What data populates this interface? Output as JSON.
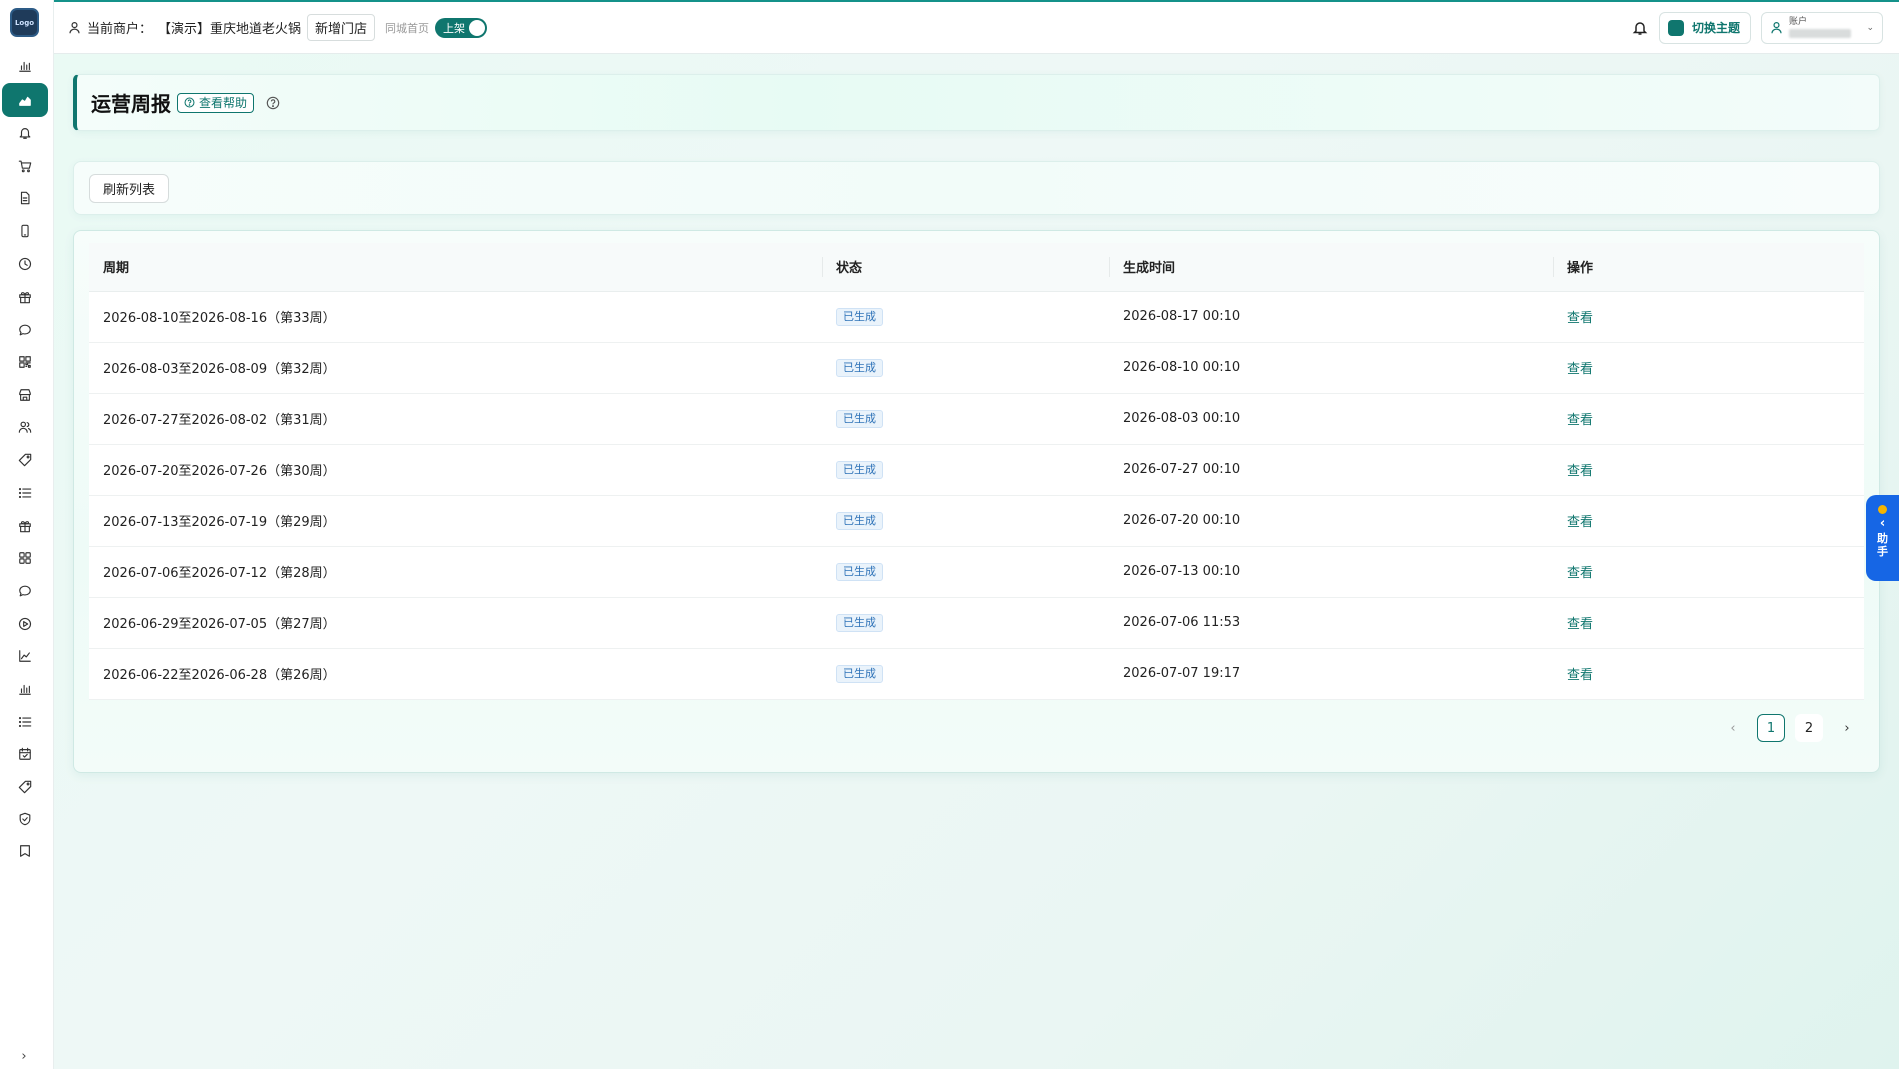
{
  "header": {
    "merchant_label": "当前商户：",
    "merchant_name": "【演示】重庆地道老火锅",
    "add_store": "新增门店",
    "city_label": "同城首页",
    "toggle_label": "上架",
    "theme_button": "切换主题",
    "account_label": "账户",
    "account_caret": "⌄"
  },
  "page": {
    "title": "运营周报",
    "help_button": "查看帮助",
    "refresh_button": "刷新列表"
  },
  "table": {
    "columns": [
      "周期",
      "状态",
      "生成时间",
      "操作"
    ],
    "rows": [
      {
        "period": "2026-08-10至2026-08-16（第33周）",
        "status": "已生成",
        "time": "2026-08-17 00:10",
        "action": "查看"
      },
      {
        "period": "2026-08-03至2026-08-09（第32周）",
        "status": "已生成",
        "time": "2026-08-10 00:10",
        "action": "查看"
      },
      {
        "period": "2026-07-27至2026-08-02（第31周）",
        "status": "已生成",
        "time": "2026-08-03 00:10",
        "action": "查看"
      },
      {
        "period": "2026-07-20至2026-07-26（第30周）",
        "status": "已生成",
        "time": "2026-07-27 00:10",
        "action": "查看"
      },
      {
        "period": "2026-07-13至2026-07-19（第29周）",
        "status": "已生成",
        "time": "2026-07-20 00:10",
        "action": "查看"
      },
      {
        "period": "2026-07-06至2026-07-12（第28周）",
        "status": "已生成",
        "time": "2026-07-13 00:10",
        "action": "查看"
      },
      {
        "period": "2026-06-29至2026-07-05（第27周）",
        "status": "已生成",
        "time": "2026-07-06 11:53",
        "action": "查看"
      },
      {
        "period": "2026-06-22至2026-06-28（第26周）",
        "status": "已生成",
        "time": "2026-07-07 19:17",
        "action": "查看"
      }
    ]
  },
  "pagination": {
    "prev": "‹",
    "pages": [
      "1",
      "2"
    ],
    "current": "1",
    "next": "›"
  },
  "assistant": {
    "chevron": "‹",
    "text": "助手"
  },
  "sidebar": {
    "collapse": "›",
    "icons": [
      "bar-chart-icon",
      "area-chart-icon",
      "bell-icon",
      "cart-icon",
      "document-icon",
      "phone-icon",
      "clock-icon",
      "gift-icon",
      "chat-icon",
      "qr-icon",
      "store-icon",
      "users-icon",
      "tag-icon",
      "list-icon",
      "gift-icon",
      "grid-icon",
      "chat-icon",
      "play-icon",
      "line-chart-icon",
      "bar-chart-icon",
      "list-icon",
      "calendar-icon",
      "tag-icon",
      "shield-icon",
      "bookmark-icon"
    ]
  },
  "colors": {
    "primary": "#0f766e",
    "status_tag": "#2f73b8",
    "assistant": "#1666e5"
  }
}
